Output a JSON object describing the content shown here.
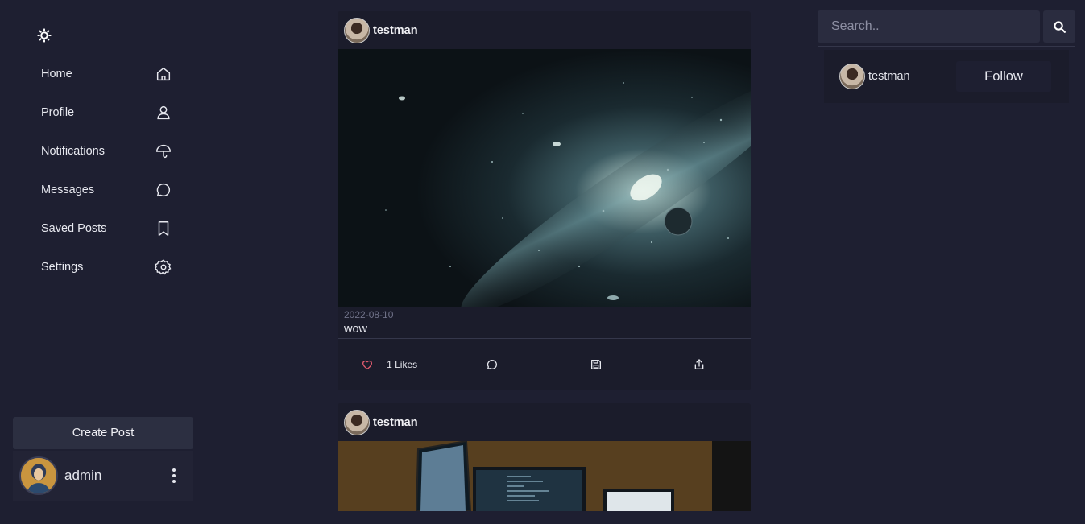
{
  "sidebar": {
    "theme_icon": "sun-icon",
    "items": [
      {
        "label": "Home",
        "icon": "home-icon"
      },
      {
        "label": "Profile",
        "icon": "user-icon"
      },
      {
        "label": "Notifications",
        "icon": "umbrella-icon"
      },
      {
        "label": "Messages",
        "icon": "chat-bubble-icon"
      },
      {
        "label": "Saved Posts",
        "icon": "bookmark-icon"
      },
      {
        "label": "Settings",
        "icon": "gear-icon"
      }
    ],
    "create_post_label": "Create Post",
    "current_user": {
      "name": "admin",
      "menu_icon": "kebab-menu-icon"
    }
  },
  "feed": {
    "posts": [
      {
        "username": "testman",
        "date": "2022-08-10",
        "caption": "wow",
        "likes_label": "1 Likes",
        "actions": [
          "heart-icon",
          "comment-icon",
          "save-icon",
          "share-icon"
        ]
      },
      {
        "username": "testman"
      }
    ]
  },
  "right_panel": {
    "search": {
      "placeholder": "Search..",
      "button_icon": "search-icon"
    },
    "suggestions": [
      {
        "username": "testman",
        "follow_label": "Follow"
      }
    ]
  },
  "colors": {
    "background": "#1e1f31",
    "card": "#1b1c2b",
    "heart": "#e25b6f"
  }
}
